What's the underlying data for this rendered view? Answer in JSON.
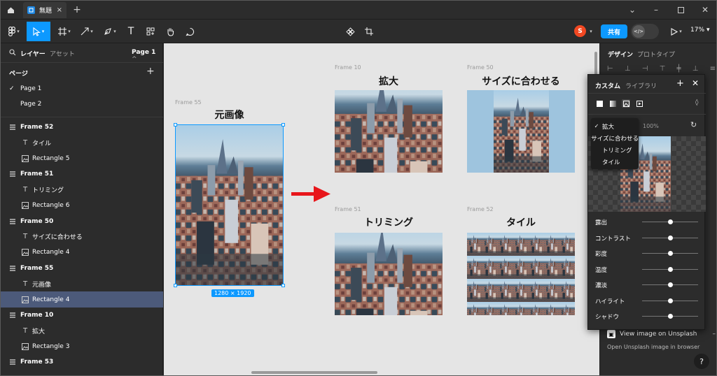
{
  "titlebar": {
    "tab_title": "無題"
  },
  "toolbar": {
    "share_label": "共有",
    "avatar_initial": "S",
    "zoom_label": "17%"
  },
  "left_panel": {
    "tab_layers": "レイヤー",
    "tab_assets": "アセット",
    "page_selector": "Page 1",
    "pages_header": "ページ",
    "pages": [
      {
        "label": "Page 1",
        "current": true
      },
      {
        "label": "Page 2",
        "current": false
      }
    ],
    "layers": [
      {
        "label": "Frame 52",
        "kind": "frame"
      },
      {
        "label": "タイル",
        "kind": "text"
      },
      {
        "label": "Rectangle 5",
        "kind": "image"
      },
      {
        "label": "Frame 51",
        "kind": "frame"
      },
      {
        "label": "トリミング",
        "kind": "text"
      },
      {
        "label": "Rectangle 6",
        "kind": "image"
      },
      {
        "label": "Frame 50",
        "kind": "frame"
      },
      {
        "label": "サイズに合わせる",
        "kind": "text"
      },
      {
        "label": "Rectangle 4",
        "kind": "image"
      },
      {
        "label": "Frame 55",
        "kind": "frame"
      },
      {
        "label": "元画像",
        "kind": "text"
      },
      {
        "label": "Rectangle 4",
        "kind": "image",
        "selected": true
      },
      {
        "label": "Frame 10",
        "kind": "frame"
      },
      {
        "label": "拡大",
        "kind": "text"
      },
      {
        "label": "Rectangle 3",
        "kind": "image"
      },
      {
        "label": "Frame 53",
        "kind": "frame"
      }
    ]
  },
  "canvas": {
    "original": {
      "frame_label": "Frame 55",
      "title": "元画像",
      "dimensions": "1280 × 1920"
    },
    "fill": {
      "frame_label": "Frame 10",
      "title": "拡大"
    },
    "fit": {
      "frame_label": "Frame 50",
      "title": "サイズに合わせる"
    },
    "crop": {
      "frame_label": "Frame 51",
      "title": "トリミング"
    },
    "tile": {
      "frame_label": "Frame 52",
      "title": "タイル"
    },
    "colors": {
      "accent": "#0d99ff",
      "arrow": "#e8161b",
      "canvas_bg": "#e5e5e5",
      "fit_bg": "#9ec4de"
    }
  },
  "right_panel": {
    "tab_design": "デザイン",
    "tab_prototype": "プロトタイプ",
    "unsplash_title": "View image on Unsplash",
    "unsplash_subtitle": "Open Unsplash image in browser",
    "help": "?"
  },
  "fill_popup": {
    "tab_custom": "カスタム",
    "tab_library": "ライブラリ",
    "opacity": "100%",
    "fit_options": [
      {
        "label": "拡大",
        "selected": true
      },
      {
        "label": "サイズに合わせる",
        "selected": false
      },
      {
        "label": "トリミング",
        "selected": false
      },
      {
        "label": "タイル",
        "selected": false
      }
    ],
    "adjustments": [
      {
        "label": "露出",
        "value": 0
      },
      {
        "label": "コントラスト",
        "value": 0
      },
      {
        "label": "彩度",
        "value": 0
      },
      {
        "label": "温度",
        "value": 0
      },
      {
        "label": "濃淡",
        "value": 0
      },
      {
        "label": "ハイライト",
        "value": 0
      },
      {
        "label": "シャドウ",
        "value": 0
      }
    ]
  }
}
